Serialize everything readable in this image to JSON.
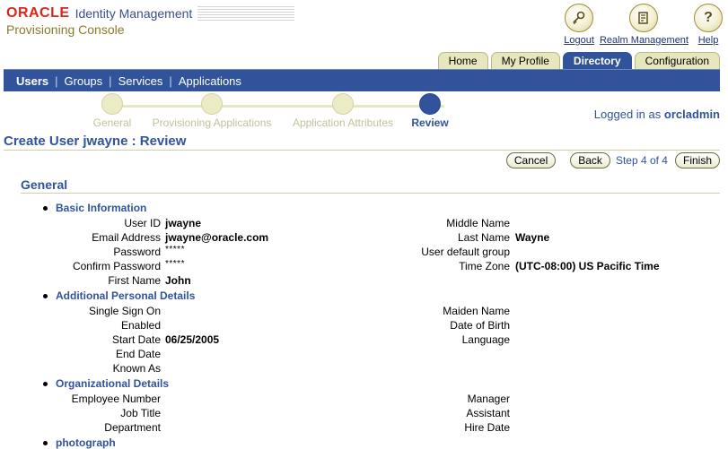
{
  "brand": {
    "logo": "ORACLE",
    "product": "Identity Management",
    "console": "Provisioning Console"
  },
  "global_links": [
    {
      "label": "Logout",
      "icon": "key-icon"
    },
    {
      "label": "Realm Management",
      "icon": "realm-icon"
    },
    {
      "label": "Help",
      "icon": "help-icon"
    }
  ],
  "tabs": [
    {
      "label": "Home",
      "active": false
    },
    {
      "label": "My Profile",
      "active": false
    },
    {
      "label": "Directory",
      "active": true
    },
    {
      "label": "Configuration",
      "active": false
    }
  ],
  "subnav": [
    {
      "label": "Users",
      "active": true
    },
    {
      "label": "Groups",
      "active": false
    },
    {
      "label": "Services",
      "active": false
    },
    {
      "label": "Applications",
      "active": false
    }
  ],
  "train": [
    {
      "label": "General",
      "current": false
    },
    {
      "label": "Provisioning Applications",
      "current": false
    },
    {
      "label": "Application Attributes",
      "current": false
    },
    {
      "label": "Review",
      "current": true
    }
  ],
  "logged_in": {
    "prefix": "Logged in as",
    "user": "orcladmin"
  },
  "page": {
    "title": "Create User jwayne : Review"
  },
  "actions": {
    "cancel": "Cancel",
    "back": "Back",
    "step": "Step 4 of 4",
    "finish": "Finish"
  },
  "section": {
    "title": "General"
  },
  "basic": {
    "heading": "Basic Information",
    "left": [
      {
        "label": "User ID",
        "value": "jwayne"
      },
      {
        "label": "Email Address",
        "value": "jwayne@oracle.com"
      },
      {
        "label": "Password",
        "value": "*****"
      },
      {
        "label": "Confirm Password",
        "value": "*****"
      },
      {
        "label": "First Name",
        "value": "John"
      }
    ],
    "right": [
      {
        "label": "Middle Name",
        "value": ""
      },
      {
        "label": "Last Name",
        "value": "Wayne"
      },
      {
        "label": "User default group",
        "value": ""
      },
      {
        "label": "Time Zone",
        "value": "(UTC-08:00) US Pacific Time"
      }
    ]
  },
  "personal": {
    "heading": "Additional Personal Details",
    "left": [
      {
        "label": "Single Sign On",
        "value": ""
      },
      {
        "label": "Enabled",
        "value": ""
      },
      {
        "label": "Start Date",
        "value": "06/25/2005"
      },
      {
        "label": "End Date",
        "value": ""
      },
      {
        "label": "Known As",
        "value": ""
      }
    ],
    "right": [
      {
        "label": "Maiden Name",
        "value": ""
      },
      {
        "label": "Date of Birth",
        "value": ""
      },
      {
        "label": "Language",
        "value": ""
      }
    ]
  },
  "org": {
    "heading": "Organizational Details",
    "left": [
      {
        "label": "Employee Number",
        "value": ""
      },
      {
        "label": "Job Title",
        "value": ""
      },
      {
        "label": "Department",
        "value": ""
      }
    ],
    "right": [
      {
        "label": "Manager",
        "value": ""
      },
      {
        "label": "Assistant",
        "value": ""
      },
      {
        "label": "Hire Date",
        "value": ""
      }
    ]
  },
  "photo": {
    "heading": "photograph"
  },
  "colors": {
    "accent": "#30539b",
    "tab_inactive": "#e7e7bd",
    "brand_red": "#e2231a"
  }
}
